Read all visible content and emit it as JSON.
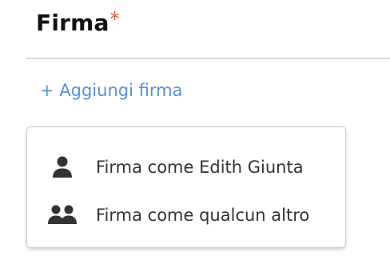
{
  "section": {
    "title": "Firma",
    "required_marker": "*"
  },
  "add_signature": {
    "label": "+ Aggiungi firma"
  },
  "dropdown": {
    "items": [
      {
        "label": "Firma come Edith Giunta",
        "icon": "user-icon"
      },
      {
        "label": "Firma come qualcun altro",
        "icon": "users-icon"
      }
    ]
  },
  "colors": {
    "required": "#e5533d",
    "link": "#5b8fe0",
    "text": "#333333",
    "icon": "#333333"
  }
}
